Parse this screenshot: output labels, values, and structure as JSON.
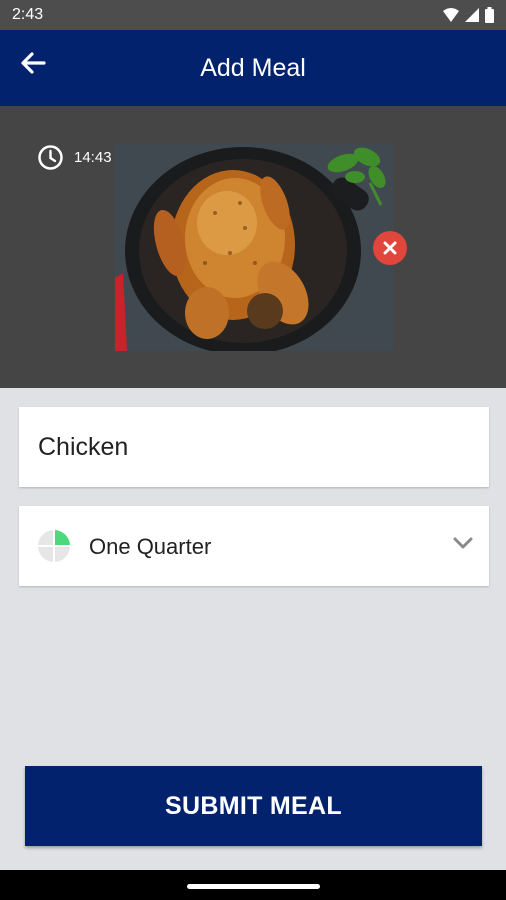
{
  "status_bar": {
    "time": "2:43",
    "icons": [
      "wifi-icon",
      "signal-icon",
      "battery-icon"
    ]
  },
  "app_bar": {
    "title": "Add Meal",
    "back_icon": "arrow-left-icon",
    "color": "#02226e"
  },
  "photo": {
    "timestamp": "14:43",
    "clock_icon": "clock-icon",
    "subject": "roast chicken",
    "remove_icon": "close-icon",
    "remove_color": "#e0463b"
  },
  "form": {
    "meal_name": "Chicken",
    "portion": {
      "selected": "One Quarter",
      "icon": "quarter-pie-icon",
      "fraction": 0.25,
      "fill_color": "#4cd97b"
    }
  },
  "submit": {
    "label": "SUBMIT MEAL"
  }
}
